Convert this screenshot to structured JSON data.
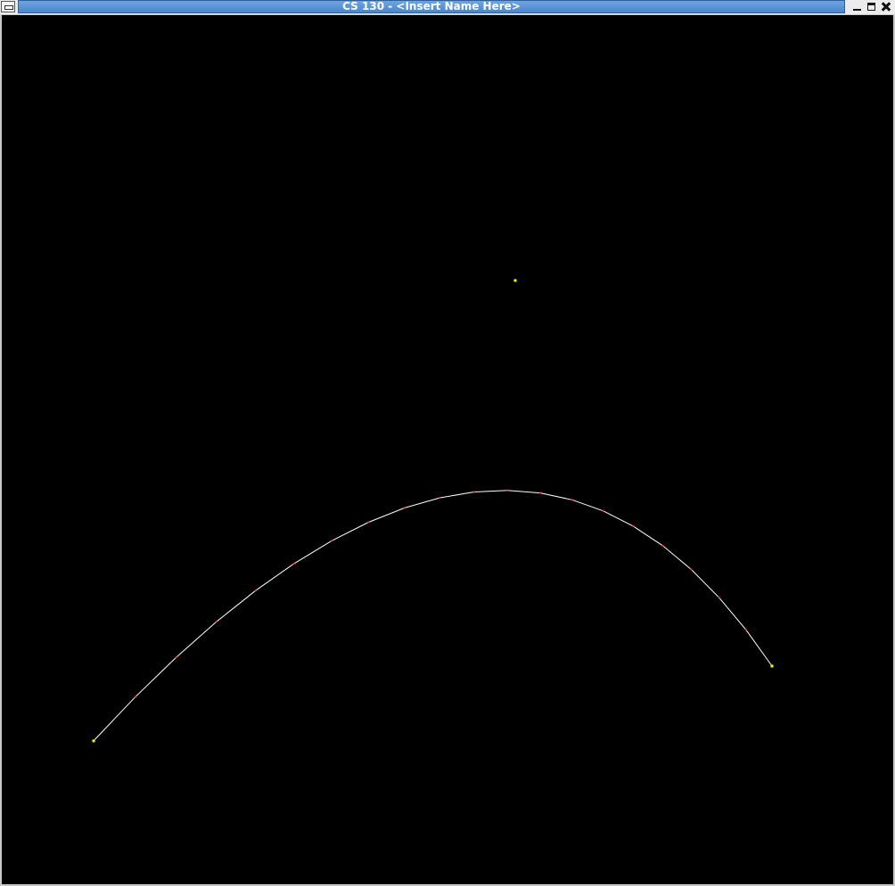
{
  "window": {
    "title": "CS 130 - <Insert Name Here>"
  },
  "icons": {
    "window_menu": "window-menu-icon",
    "minimize": "minimize-icon",
    "maximize": "maximize-icon",
    "close": "close-icon"
  },
  "colors": {
    "canvas_background": "#000000",
    "curve": "#ffffff",
    "control_point": "#ffff00",
    "sample_point": "#ff3333",
    "titlebar": "#4a87cc"
  }
}
